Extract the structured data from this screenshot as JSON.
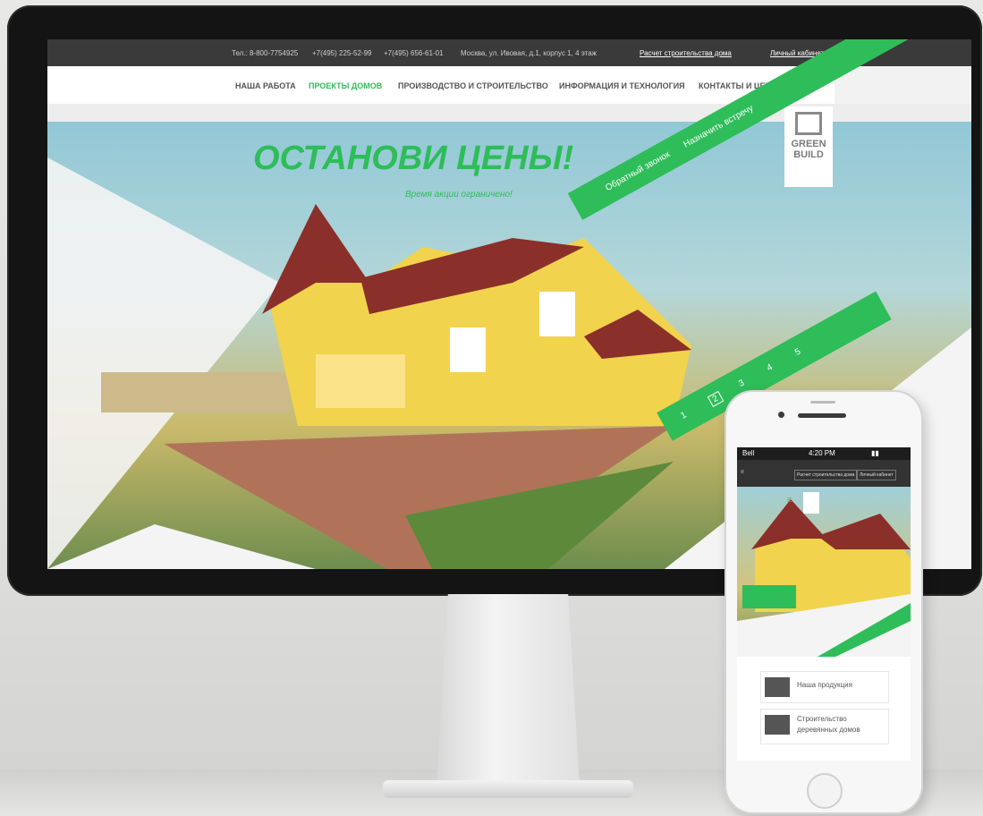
{
  "topbar": {
    "phone_1": "Тел.: 8-800-7754925",
    "phone_2": "+7(495) 225-52-99",
    "phone_3": "+7(495) 656-61-01",
    "address": "Москва, ул. Ивовая, д.1, корпус 1, 4 этаж",
    "calc_link": "Расчет строительства дома",
    "cabinet_link": "Личный кабинет"
  },
  "nav": {
    "items": [
      {
        "label": "НАША РАБОТА"
      },
      {
        "label": "ПРОЕКТЫ ДОМОВ"
      },
      {
        "label": "ПРОИЗВОДСТВО И СТРОИТЕЛЬСТВО"
      },
      {
        "label": "ИНФОРМАЦИЯ И ТЕХНОЛОГИЯ"
      },
      {
        "label": "КОНТАКТЫ И ЦЕНЫ"
      }
    ],
    "active_index": 1
  },
  "hero": {
    "headline": "ОСТАНОВИ ЦЕНЫ!",
    "subline": "Время акции ограничено!",
    "callback": "Обратный звонок",
    "meeting": "Назначить встречу",
    "logo_line1": "GREEN",
    "logo_line2": "BUILD",
    "slides": [
      "1",
      "2",
      "3",
      "4",
      "5"
    ],
    "active_slide": "2"
  },
  "phone": {
    "carrier": "Bell",
    "time": "4:20 PM",
    "calc_button": "Расчет строительства дома",
    "cabinet_button": "Личный кабинет",
    "card1": "Наша продукция",
    "card2_line1": "Строительство",
    "card2_line2": "деревянных домов"
  },
  "colors": {
    "brand_green": "#2ebd59",
    "topbar": "#3a3a3a"
  }
}
